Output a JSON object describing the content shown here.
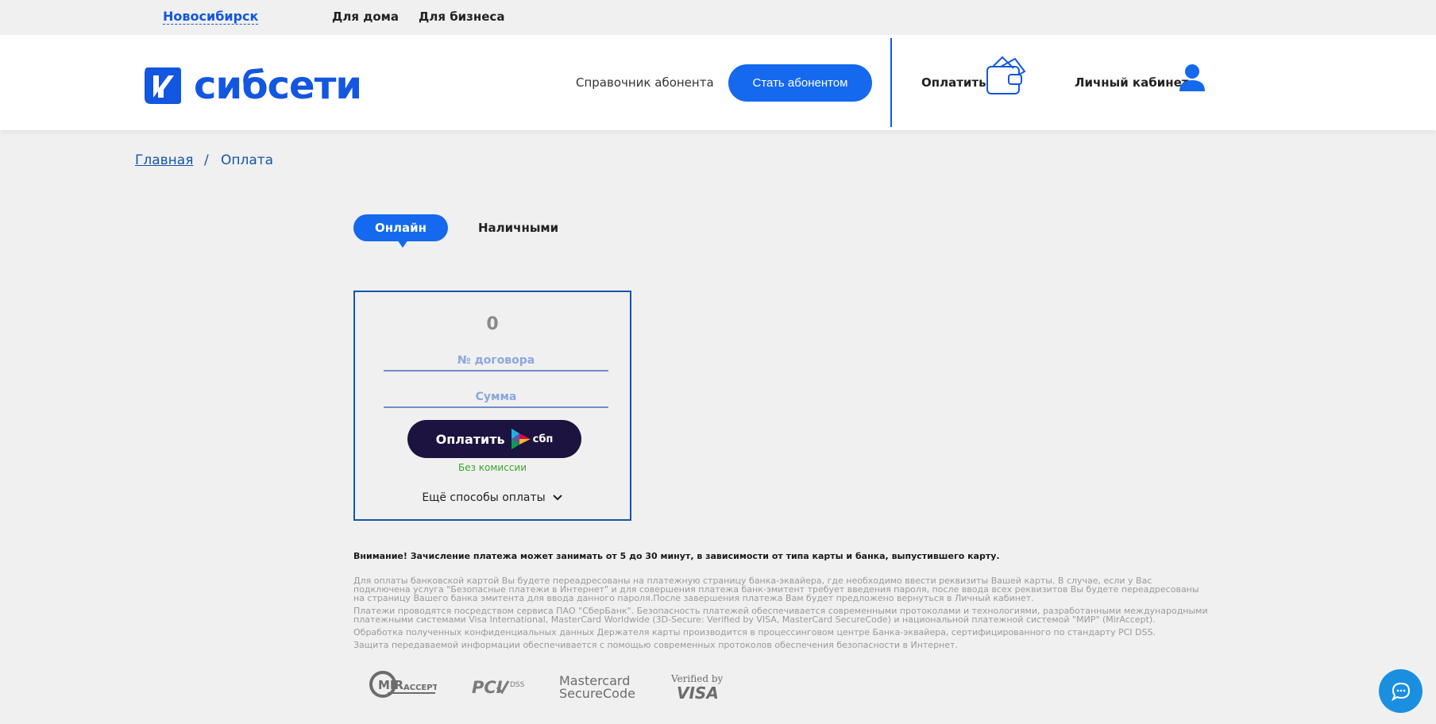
{
  "topbar": {
    "city": "Новосибирск",
    "links": [
      "Для дома",
      "Для бизнеса"
    ]
  },
  "header": {
    "logo_text": "сибсети",
    "guide_link": "Справочник абонента",
    "become_button": "Стать абонентом",
    "pay_link": "Оплатить",
    "cabinet_link": "Личный кабинет"
  },
  "breadcrumb": {
    "home": "Главная",
    "separator": "/",
    "current": "Оплата"
  },
  "tabs": {
    "online": "Онлайн",
    "cash": "Наличными"
  },
  "payment": {
    "amount_display": "0",
    "contract_placeholder": "№ договора",
    "sum_placeholder": "Сумма",
    "pay_button": "Оплатить",
    "sbp_label": "сбп",
    "no_commission": "Без комиссии",
    "more_methods": "Ещё способы оплаты"
  },
  "notice": {
    "warning": "Внимание! Зачисление платежа может занимать от 5 до 30 минут, в зависимости от типа карты и банка, выпустившего карту.",
    "paragraphs": [
      "Для оплаты банковской картой Вы будете переадресованы на платежную страницу банка-эквайера, где необходимо ввести реквизиты Вашей карты. В случае, если у Вас подключена услуга \"Безопасные платежи в Интернет\" и для совершения платежа банк-эмитент требует введения пароля, после ввода всех реквизитов Вы будете переадресованы на страницу Вашего банка эмитента для ввода данного пароля.После завершения платежа Вам будет предложено вернуться в Личный кабинет.",
      "Платежи проводятся посредством сервиса ПАО \"СберБанк\". Безопасность платежей обеспечивается современными протоколами и технологиями, разработанными международными платежными системами Visa International, MasterCard Worldwide (3D-Secure: Verified by VISA, MasterCard SecureCode) и национальной платежной системой \"МИР\" (MirAccept).",
      "Обработка полученных конфиденциальных данных Держателя карты производится в процессинговом центре Банка-эквайера, сертифицированного по стандарту PCI DSS.",
      "Защита передаваемой информации обеспечивается с помощью современных протоколов обеспечения безопасности в Интернет."
    ]
  },
  "security_logos": {
    "mir": "MirAccept",
    "pci": "PCI DSS",
    "mastercard": [
      "Mastercard",
      "SecureCode"
    ],
    "visa": [
      "Verified by",
      "VISA"
    ]
  },
  "colors": {
    "brand_blue": "#1356e0",
    "button_blue": "#1469ee",
    "sbp_button": "#1c1340",
    "success_green": "#3aa52d",
    "chat_blue": "#1a8fe0"
  }
}
